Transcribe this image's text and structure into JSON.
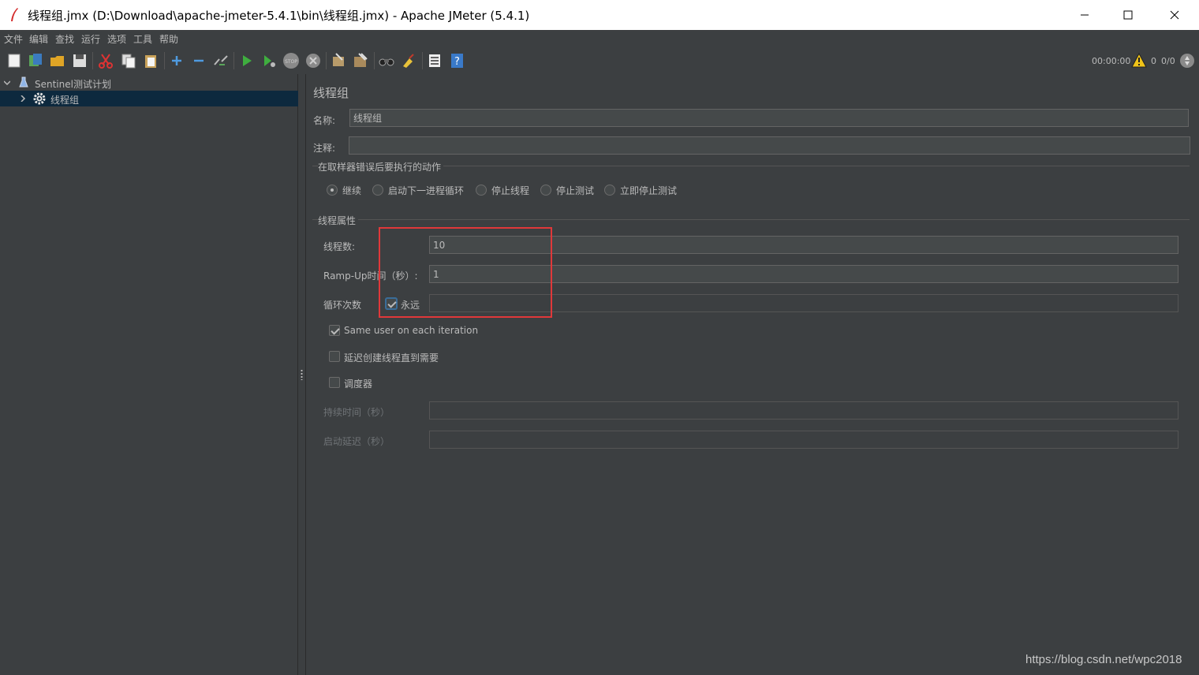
{
  "window": {
    "title": "线程组.jmx (D:\\Download\\apache-jmeter-5.4.1\\bin\\线程组.jmx) - Apache JMeter (5.4.1)"
  },
  "menu": [
    "文件",
    "编辑",
    "查找",
    "运行",
    "选项",
    "工具",
    "帮助"
  ],
  "status": {
    "elapsed": "00:00:00",
    "warnings": "0",
    "threads": "0/0"
  },
  "tree": {
    "root_label": "Sentinel测试计划",
    "child_label": "线程组"
  },
  "panel": {
    "heading": "线程组",
    "name_label": "名称:",
    "name_value": "线程组",
    "comment_label": "注释:",
    "comment_value": "",
    "error_section": "在取样器错误后要执行的动作",
    "error_options": [
      "继续",
      "启动下一进程循环",
      "停止线程",
      "停止测试",
      "立即停止测试"
    ],
    "error_selected": "继续",
    "props_section": "线程属性",
    "threads_label": "线程数:",
    "threads_value": "10",
    "rampup_label": "Ramp-Up时间（秒）:",
    "rampup_value": "1",
    "loop_label": "循环次数",
    "forever_label": "永远",
    "forever_checked": true,
    "loop_value": "",
    "same_user_label": "Same user on each iteration",
    "same_user_checked": true,
    "delay_label": "延迟创建线程直到需要",
    "delay_checked": false,
    "scheduler_label": "调度器",
    "scheduler_checked": false,
    "duration_label": "持续时间（秒）",
    "duration_value": "",
    "startup_delay_label": "启动延迟（秒）",
    "startup_delay_value": ""
  },
  "watermark": "https://blog.csdn.net/wpc2018",
  "colors": {
    "background": "#3c3f41",
    "selection": "#0d293e",
    "highlight": "#e0383a"
  }
}
